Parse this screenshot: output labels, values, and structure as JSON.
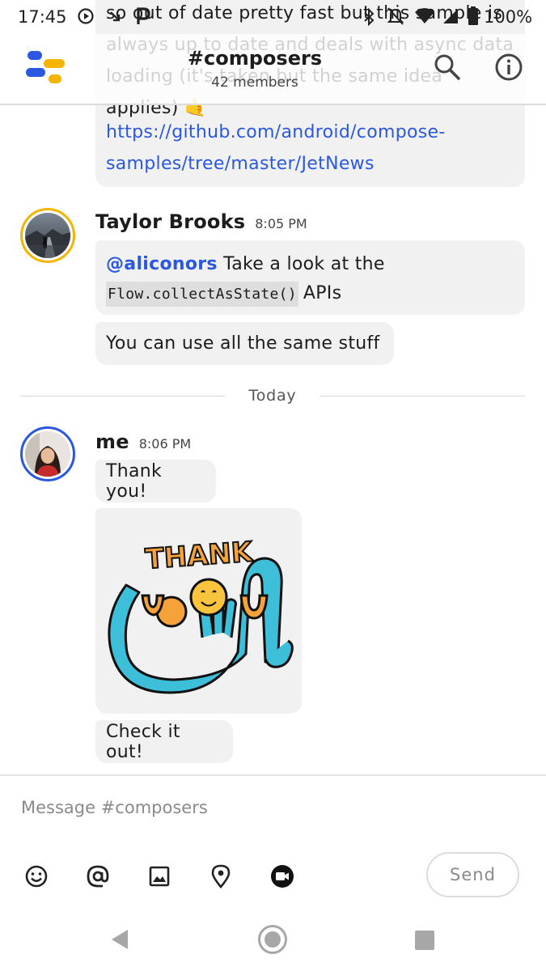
{
  "status_bar": {
    "time": "17:45",
    "battery": "100%"
  },
  "header": {
    "channel": "#composers",
    "members": "42 members"
  },
  "messages": {
    "partial_text": "so out of date pretty fast but this sample is always up to date and deals with async data loading (it's taken but the same idea applies) 🤙",
    "partial_link": "https://github.com/android/compose-samples/tree/master/JetNews",
    "taylor": {
      "author": "Taylor Brooks",
      "time": "8:05 PM",
      "mention": "@aliconors",
      "text1": " Take a look at the",
      "code": "Flow.collectAsState()",
      "text2": "APIs",
      "text3": "You can use all the same stuff"
    },
    "divider": "Today",
    "me": {
      "author": "me",
      "time": "8:06 PM",
      "text1": "Thank you!",
      "sticker_text_top": "THANK",
      "sticker_text_bottom": "YOU",
      "text2": "Check it out!"
    }
  },
  "input": {
    "placeholder": "Message #composers",
    "value": "",
    "send_label": "Send"
  },
  "icons": [
    "app-logo-icon",
    "search-icon",
    "info-icon",
    "emoji-icon",
    "mention-icon",
    "image-icon",
    "location-icon",
    "video-icon",
    "back-nav-icon",
    "home-nav-icon",
    "recents-nav-icon"
  ],
  "colors": {
    "link": "#2a58e1",
    "avatar_ring_other": "#f4b400",
    "avatar_ring_me": "#2a58e1",
    "bubble": "#f1f1f1"
  }
}
